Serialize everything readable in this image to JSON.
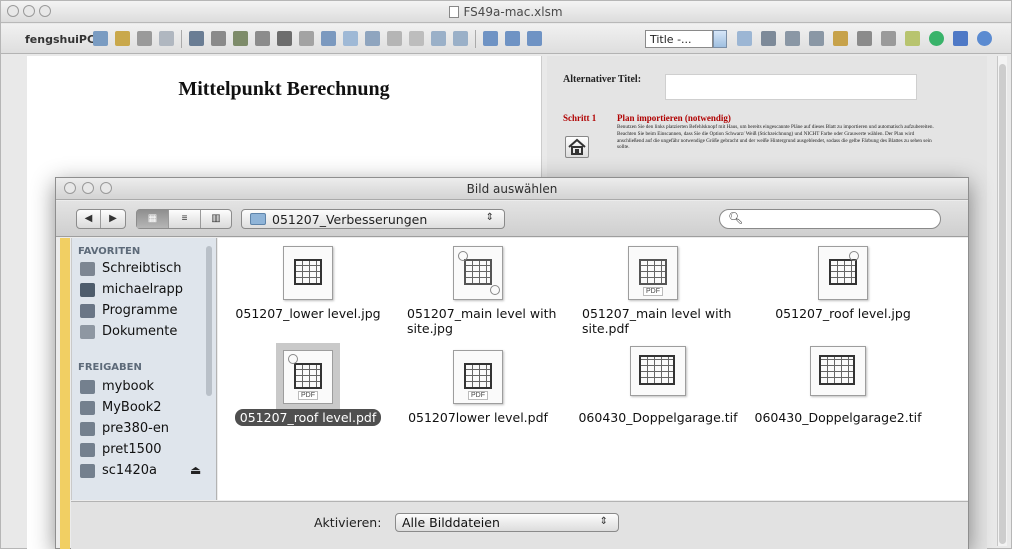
{
  "main_window": {
    "title": "FS49a-mac.xlsm",
    "toolbar_label": "fengshuiPC",
    "title_select_value": "Title -...",
    "sheet_heading": "Mittelpunkt Berechnung",
    "alt_title_label": "Alternativer Titel:",
    "step_label": "Schritt 1",
    "step_title": "Plan importieren (notwendig)",
    "step_body": "Benutzen Sie den links platzierten Befehlsknopf mit Haus, um bereits eingescannte Pläne auf dieses Blatt zu importieren und automatisch aufzubereiten. Beachten Sie beim Einscannen, dass Sie die Option Schwarz/ Weiß (Stichzeichnung) und NICHT Farbe oder Grauwerte wählen. Der Plan wird anschließend auf die ungefähr notwendige Größe gebracht und der weiße Hintergrund ausgeblendet, sodass die gelbe Färbung des Blattes zu sehen sein sollte."
  },
  "dialog": {
    "title": "Bild auswählen",
    "nav_back": "◀",
    "nav_forward": "▶",
    "view_icon": "▦",
    "view_list": "≡",
    "view_columns": "▥",
    "current_folder": "051207_Verbesserungen",
    "popup_arrows": "⇕",
    "search_placeholder": "",
    "sidebar": {
      "favorites_header": "FAVORITEN",
      "favorites": [
        {
          "label": "Schreibtisch",
          "icon": "desktop-icon"
        },
        {
          "label": "michaelrapp",
          "icon": "home-icon"
        },
        {
          "label": "Programme",
          "icon": "applications-icon"
        },
        {
          "label": "Dokumente",
          "icon": "documents-icon"
        }
      ],
      "shared_header": "FREIGABEN",
      "shared": [
        {
          "label": "mybook",
          "icon": "computer-icon"
        },
        {
          "label": "MyBook2",
          "icon": "computer-icon"
        },
        {
          "label": "pre380-en",
          "icon": "computer-icon"
        },
        {
          "label": "pret1500",
          "icon": "computer-icon"
        },
        {
          "label": "sc1420a",
          "icon": "computer-icon"
        }
      ],
      "eject": "⏏"
    },
    "files": [
      {
        "name": "051207_lower level.jpg",
        "type": "jpg",
        "selected": false
      },
      {
        "name": "051207_main level with site.jpg",
        "type": "jpg",
        "selected": false
      },
      {
        "name": "051207_main level with site.pdf",
        "type": "pdf",
        "selected": false
      },
      {
        "name": "051207_roof level.jpg",
        "type": "jpg",
        "selected": false
      },
      {
        "name": "051207_roof level.pdf",
        "type": "pdf",
        "selected": true
      },
      {
        "name": "051207lower level.pdf",
        "type": "pdf",
        "selected": false
      },
      {
        "name": "060430_Doppelgarage.tif",
        "type": "tif",
        "selected": false
      },
      {
        "name": "060430_Doppelgarage2.tif",
        "type": "tif",
        "selected": false
      }
    ],
    "pdf_badge": "PDF",
    "activate_label": "Aktivieren:",
    "activate_value": "Alle Bilddateien"
  },
  "colors": {
    "selection": "#4f4f4f",
    "sidebar_bg": "#dfe5ec",
    "step_red": "#b00000",
    "sheet_yellow_edge": "#f1cf63"
  }
}
